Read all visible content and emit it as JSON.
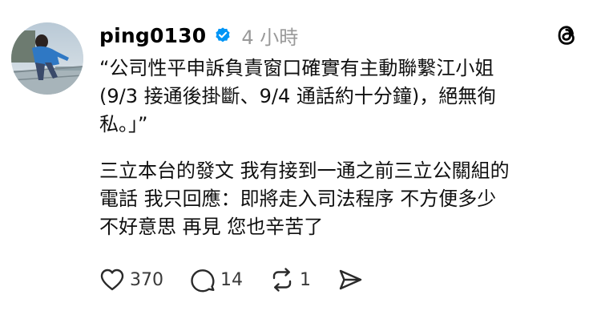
{
  "post": {
    "author": {
      "username": "ping0130",
      "verified_icon": "verified-badge-icon",
      "avatar": "avatar-photo"
    },
    "timestamp": "4 小時",
    "app_icon": "threads-logo-icon",
    "quote_lines": [
      "“公司性平申訴負責窗口確實有主動聯繫江小姐",
      "(9/3 接通後掛斷、9/4 通話約十分鐘)，絕無徇",
      "私。」”"
    ],
    "body_lines": [
      "三立本台的發文 我有接到一通之前三立公關組的",
      "電話 我只回應：即將走入司法程序 不方便多少",
      "不好意思 再見 您也辛苦了"
    ],
    "actions": {
      "like": {
        "icon": "heart-icon",
        "count": "370"
      },
      "reply": {
        "icon": "comment-icon",
        "count": "14"
      },
      "repost": {
        "icon": "repost-icon",
        "count": "1"
      },
      "share": {
        "icon": "send-icon"
      }
    },
    "colors": {
      "text": "#101010",
      "muted": "#999999",
      "verified": "#0095f6"
    }
  }
}
